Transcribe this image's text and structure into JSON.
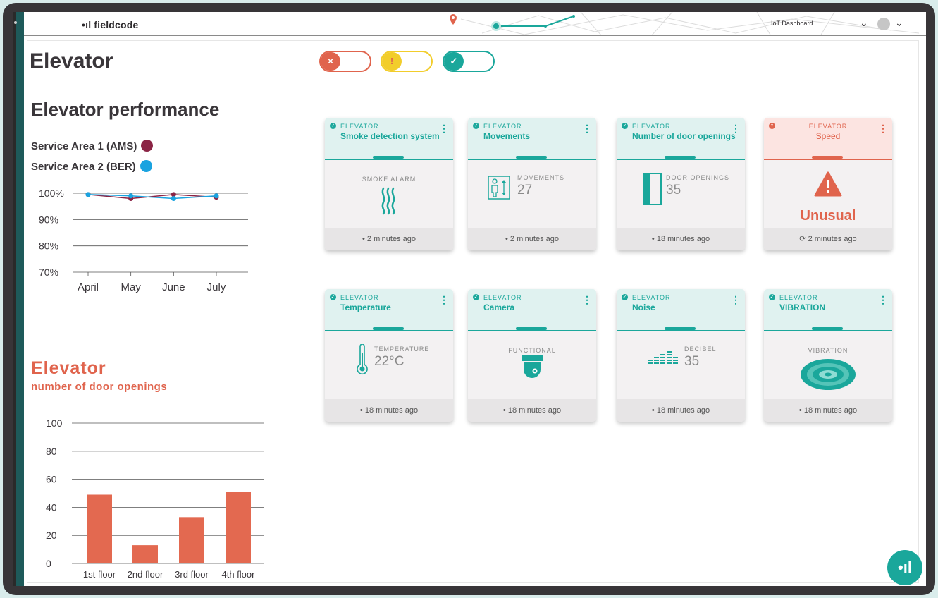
{
  "app": {
    "logo_text": "fieldcode",
    "logo_mark": "•ıl",
    "dashboard_select": "IoT Dashboard"
  },
  "page": {
    "title": "Elevator"
  },
  "toggles": [
    {
      "status": "error",
      "icon": "×",
      "color": "#e0644d"
    },
    {
      "status": "warning",
      "icon": "!",
      "color": "#f2cd2b"
    },
    {
      "status": "ok",
      "icon": "✓",
      "color": "#1aa79b"
    }
  ],
  "performance": {
    "title": "Elevator performance",
    "legend": [
      {
        "label": "Service Area 1 (AMS)",
        "color": "#8b2445"
      },
      {
        "label": "Service Area 2 (BER)",
        "color": "#1aa3e0"
      }
    ]
  },
  "door_openings": {
    "title": "Elevator",
    "subtitle": "number of door openings"
  },
  "chart_data": [
    {
      "type": "line",
      "categories": [
        "April",
        "May",
        "June",
        "July"
      ],
      "y_ticks": [
        "100%",
        "90%",
        "80%",
        "70%"
      ],
      "ylim": [
        70,
        100
      ],
      "series": [
        {
          "name": "Service Area 1 (AMS)",
          "color": "#8b2445",
          "values": [
            99.5,
            98,
            99.5,
            98.5
          ]
        },
        {
          "name": "Service Area 2 (BER)",
          "color": "#1aa3e0",
          "values": [
            99.5,
            99,
            98,
            99
          ]
        }
      ]
    },
    {
      "type": "bar",
      "categories": [
        "1st floor",
        "2nd floor",
        "3rd floor",
        "4th floor"
      ],
      "values": [
        49,
        13,
        33,
        51
      ],
      "y_ticks": [
        0,
        20,
        40,
        60,
        80,
        100
      ],
      "ylim": [
        0,
        100
      ],
      "color": "#e36950"
    }
  ],
  "cards": [
    {
      "category": "ELEVATOR",
      "name": "Smoke detection system",
      "metric_label": "SMOKE ALARM",
      "metric_value": "",
      "icon": "smoke-icon",
      "footer": "2 minutes ago",
      "alert": false
    },
    {
      "category": "ELEVATOR",
      "name": "Movements",
      "metric_label": "MOVEMENTS",
      "metric_value": "27",
      "icon": "elevator-movement-icon",
      "footer": "2 minutes ago",
      "alert": false
    },
    {
      "category": "ELEVATOR",
      "name": "Number of door openings",
      "metric_label": "DOOR OPENINGS",
      "metric_value": "35",
      "icon": "door-icon",
      "footer": "18 minutes ago",
      "alert": false
    },
    {
      "category": "ELEVATOR",
      "name": "Speed",
      "metric_label": "",
      "metric_value": "Unusual",
      "icon": "warning-icon",
      "footer": "2 minutes ago",
      "alert": true
    },
    {
      "category": "ELEVATOR",
      "name": "Temperature",
      "metric_label": "TEMPERATURE",
      "metric_value": "22°C",
      "icon": "thermometer-icon",
      "footer": "18 minutes ago",
      "alert": false
    },
    {
      "category": "ELEVATOR",
      "name": "Camera",
      "metric_label": "FUNCTIONAL",
      "metric_value": "",
      "icon": "camera-icon",
      "footer": "18 minutes ago",
      "alert": false
    },
    {
      "category": "ELEVATOR",
      "name": "Noise",
      "metric_label": "DECIBEL",
      "metric_value": "35",
      "icon": "equalizer-icon",
      "footer": "18 minutes ago",
      "alert": false
    },
    {
      "category": "ELEVATOR",
      "name": "VIBRATION",
      "metric_label": "VIBRATION",
      "metric_value": "",
      "icon": "vibration-icon",
      "footer": "18 minutes ago",
      "alert": false
    }
  ]
}
